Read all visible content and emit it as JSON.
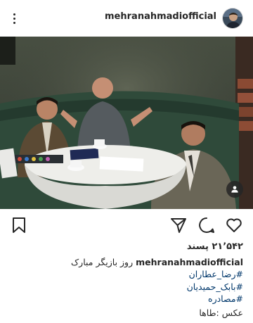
{
  "post": {
    "username": "mehranahmadiofficial",
    "likes_label": "۲۱٬۵۴۲ پسند",
    "caption_user": "mehranahmadiofficial",
    "caption_text": "روز بازیگر مبارک",
    "hashtags": [
      "#رضا_عطاران",
      "#بابک_حمیدیان",
      "#مصادره"
    ],
    "photo_credit": "عکس :طاها"
  },
  "icons": {
    "menu": "more-vertical-icon",
    "tag": "user-tag-icon",
    "like": "heart-icon",
    "comment": "comment-icon",
    "share": "send-icon",
    "save": "bookmark-icon"
  },
  "colors": {
    "text": "#262626",
    "hashtag": "#00376b",
    "tag_badge": "#262626"
  }
}
